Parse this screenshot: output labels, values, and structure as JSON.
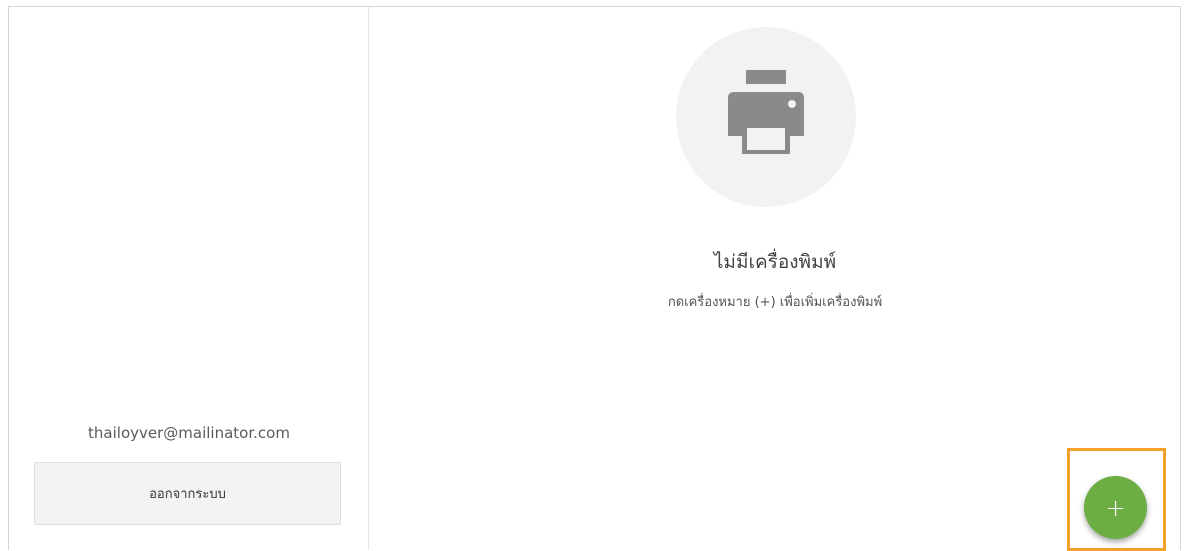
{
  "sidebar": {
    "account_email": "thailoyver@mailinator.com",
    "logout_label": "ออกจากระบบ"
  },
  "main": {
    "empty_state": {
      "icon": "printer-icon",
      "title": "ไม่มีเครื่องพิมพ์",
      "subtitle": "กดเครื่องหมาย (+) เพื่อเพิ่มเครื่องพิมพ์"
    },
    "fab": {
      "icon": "plus-icon",
      "label": "+"
    }
  },
  "colors": {
    "fab": "#6cae43",
    "highlight": "#f3a12b",
    "icon_circle": "#f2f2f2",
    "icon": "#8a8a8a"
  }
}
